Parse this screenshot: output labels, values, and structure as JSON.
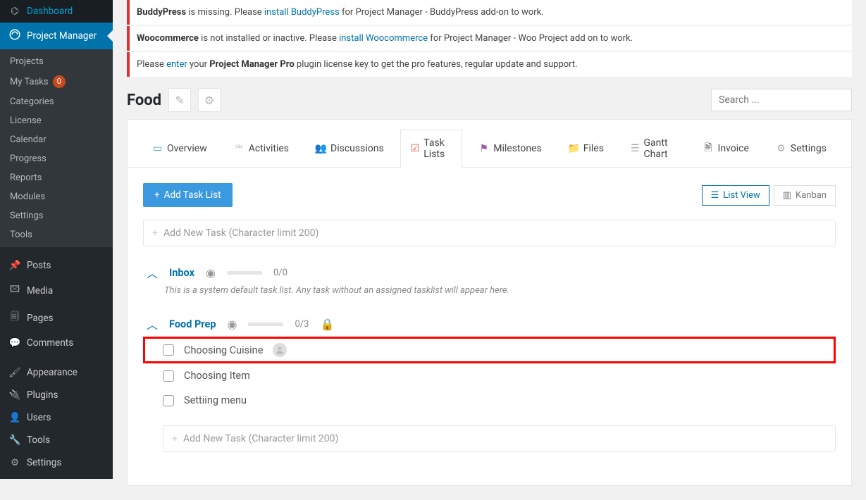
{
  "sidebar": {
    "dashboard": "Dashboard",
    "project_manager": "Project Manager",
    "sub": {
      "projects": "Projects",
      "my_tasks": "My Tasks",
      "my_tasks_badge": "0",
      "categories": "Categories",
      "license": "License",
      "calendar": "Calendar",
      "progress": "Progress",
      "reports": "Reports",
      "modules": "Modules",
      "settings": "Settings",
      "tools": "Tools"
    },
    "posts": "Posts",
    "media": "Media",
    "pages": "Pages",
    "comments": "Comments",
    "appearance": "Appearance",
    "plugins": "Plugins",
    "users": "Users",
    "tools": "Tools",
    "settings": "Settings"
  },
  "notices": {
    "n1_a": "BuddyPress",
    "n1_b": " is missing. Please ",
    "n1_link": "install BuddyPress",
    "n1_c": " for Project Manager - BuddyPress add-on to work.",
    "n2_a": "Woocommerce",
    "n2_b": " is not installed or inactive. Please ",
    "n2_link": "install Woocommerce",
    "n2_c": " for Project Manager - Woo Project add on to work.",
    "n3_a": "Please ",
    "n3_link": "enter",
    "n3_b": " your ",
    "n3_bold": "Project Manager Pro",
    "n3_c": " plugin license key to get the pro features, regular update and support."
  },
  "page": {
    "title": "Food",
    "search_placeholder": "Search ..."
  },
  "tabs": {
    "overview": "Overview",
    "activities": "Activities",
    "discussions": "Discussions",
    "task_lists": "Task Lists",
    "milestones": "Milestones",
    "files": "Files",
    "gantt": "Gantt Chart",
    "invoice": "Invoice",
    "settings": "Settings"
  },
  "actions": {
    "add_task_list": "Add Task List",
    "list_view": "List View",
    "kanban": "Kanban"
  },
  "task_input": {
    "placeholder": "Add New Task (Character limit 200)"
  },
  "lists": {
    "inbox": {
      "title": "Inbox",
      "progress": "0/0",
      "desc": "This is a system default task list. Any task without an assigned tasklist will appear here."
    },
    "food_prep": {
      "title": "Food Prep",
      "progress": "0/3",
      "tasks": [
        "Choosing Cuisine",
        "Choosing Item",
        "Settiing menu"
      ]
    }
  }
}
